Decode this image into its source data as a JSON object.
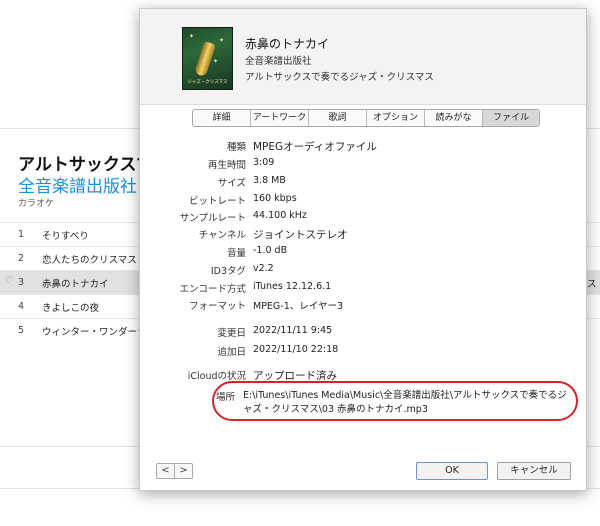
{
  "background": {
    "album_title": "アルトサックスで奏",
    "album_artist": "全音楽譜出版社",
    "album_genre": "カラオケ",
    "tracks": [
      {
        "num": "1",
        "name": "そりすべり",
        "heart": "",
        "extra": ""
      },
      {
        "num": "2",
        "name": "恋人たちのクリスマス",
        "heart": "",
        "extra": ""
      },
      {
        "num": "3",
        "name": "赤鼻のトナカイ",
        "heart": "♡",
        "extra": "ース"
      },
      {
        "num": "4",
        "name": "きよしこの夜",
        "heart": "",
        "extra": ""
      },
      {
        "num": "5",
        "name": "ウィンター・ワンダーランド",
        "heart": "",
        "extra": ""
      }
    ]
  },
  "dialog": {
    "artwork_text": "ジャズ・クリスマス",
    "song_title": "赤鼻のトナカイ",
    "artist": "全音楽譜出版社",
    "album": "アルトサックスで奏でるジャズ・クリスマス",
    "tabs": [
      "詳細",
      "アートワーク",
      "歌詞",
      "オプション",
      "読みがな",
      "ファイル"
    ],
    "active_tab": "ファイル",
    "info": {
      "kind_label": "種類",
      "kind_value": "MPEGオーディオファイル",
      "duration_label": "再生時間",
      "duration_value": "3:09",
      "size_label": "サイズ",
      "size_value": "3.8 MB",
      "bitrate_label": "ビットレート",
      "bitrate_value": "160 kbps",
      "samplerate_label": "サンプルレート",
      "samplerate_value": "44.100 kHz",
      "channel_label": "チャンネル",
      "channel_value": "ジョイントステレオ",
      "volume_label": "音量",
      "volume_value": "-1.0 dB",
      "id3_label": "ID3タグ",
      "id3_value": "v2.2",
      "encoder_label": "エンコード方式",
      "encoder_value": "iTunes 12.12.6.1",
      "format_label": "フォーマット",
      "format_value": "MPEG-1、レイヤー3",
      "modified_label": "変更日",
      "modified_value": "2022/11/11 9:45",
      "added_label": "追加日",
      "added_value": "2022/11/10 22:18",
      "icloud_label": "iCloudの状況",
      "icloud_value": "アップロード済み",
      "location_label": "場所",
      "location_value": "E:\\iTunes\\iTunes Media\\Music\\全音楽譜出版社\\アルトサックスで奏でるジャズ・クリスマス\\03 赤鼻のトナカイ.mp3"
    },
    "ok_label": "OK",
    "cancel_label": "キャンセル",
    "highlight_color": "#d3242b"
  }
}
